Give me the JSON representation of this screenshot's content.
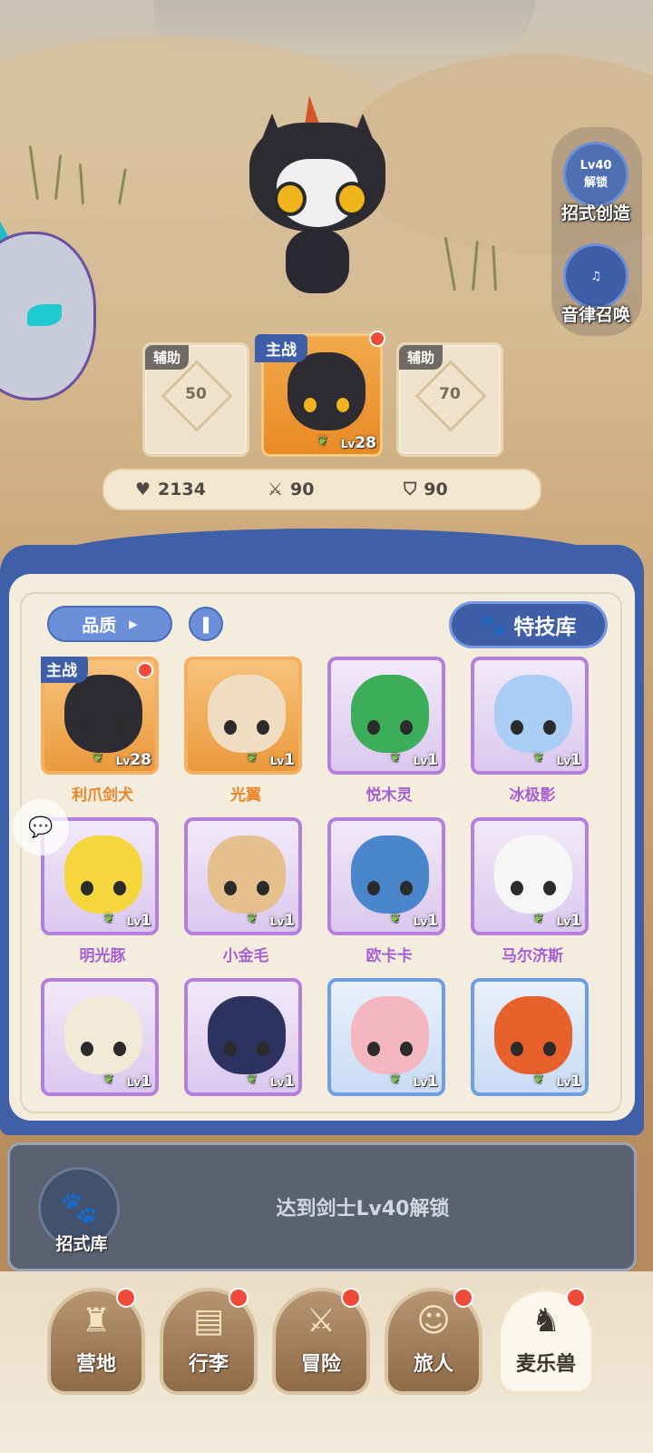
{
  "formation": {
    "left_slot": {
      "tag": "辅助",
      "value": "50"
    },
    "main_slot": {
      "tag": "主战",
      "level_prefix": "Lv",
      "level": "28"
    },
    "right_slot": {
      "tag": "辅助",
      "value": "70"
    }
  },
  "stats": {
    "hp": "2134",
    "hp_icon": "heart-icon",
    "attack": "90",
    "attack_icon": "crossed-swords-icon",
    "defense": "90",
    "defense_icon": "shield-icon"
  },
  "side_buttons": {
    "skill_create": {
      "lock_line1": "Lv40",
      "lock_line2": "解锁",
      "label": "招式创造"
    },
    "melody_summon": {
      "label": "音律召唤"
    }
  },
  "panel": {
    "quality_label": "品质",
    "skill_library_label": "特技库"
  },
  "monsters": [
    {
      "name": "利爪剑犬",
      "level": "28",
      "rarity": "orange",
      "main": true,
      "main_tag": "主战",
      "color": "#2e2c33"
    },
    {
      "name": "光翼",
      "level": "1",
      "rarity": "orange",
      "main": false,
      "color": "#f0dcc0"
    },
    {
      "name": "悦木灵",
      "level": "1",
      "rarity": "purple",
      "main": false,
      "color": "#3cae5a"
    },
    {
      "name": "冰极影",
      "level": "1",
      "rarity": "purple",
      "main": false,
      "color": "#a9cdf4"
    },
    {
      "name": "明光豚",
      "level": "1",
      "rarity": "purple",
      "main": false,
      "color": "#f5d63c"
    },
    {
      "name": "小金毛",
      "level": "1",
      "rarity": "purple",
      "main": false,
      "color": "#e6c08c"
    },
    {
      "name": "欧卡卡",
      "level": "1",
      "rarity": "purple",
      "main": false,
      "color": "#4a86cc"
    },
    {
      "name": "马尔济斯",
      "level": "1",
      "rarity": "purple",
      "main": false,
      "color": "#f6f6f4"
    },
    {
      "name": "",
      "level": "1",
      "rarity": "purple",
      "main": false,
      "color": "#f1ead6"
    },
    {
      "name": "",
      "level": "1",
      "rarity": "purple",
      "main": false,
      "color": "#2c3360"
    },
    {
      "name": "",
      "level": "1",
      "rarity": "blue",
      "main": false,
      "color": "#f4b6c0"
    },
    {
      "name": "",
      "level": "1",
      "rarity": "blue",
      "main": false,
      "color": "#e8602c"
    }
  ],
  "lock_section": {
    "label": "招式库",
    "message": "达到剑士Lv40解锁"
  },
  "bottom_nav": [
    {
      "label": "营地",
      "icon": "castle-icon",
      "badge": true,
      "active": false
    },
    {
      "label": "行李",
      "icon": "chest-icon",
      "badge": true,
      "active": false
    },
    {
      "label": "冒险",
      "icon": "crossed-swords-icon",
      "badge": true,
      "active": false
    },
    {
      "label": "旅人",
      "icon": "character-icon",
      "badge": true,
      "active": false
    },
    {
      "label": "麦乐兽",
      "icon": "monster-face-icon",
      "badge": true,
      "active": true
    }
  ]
}
